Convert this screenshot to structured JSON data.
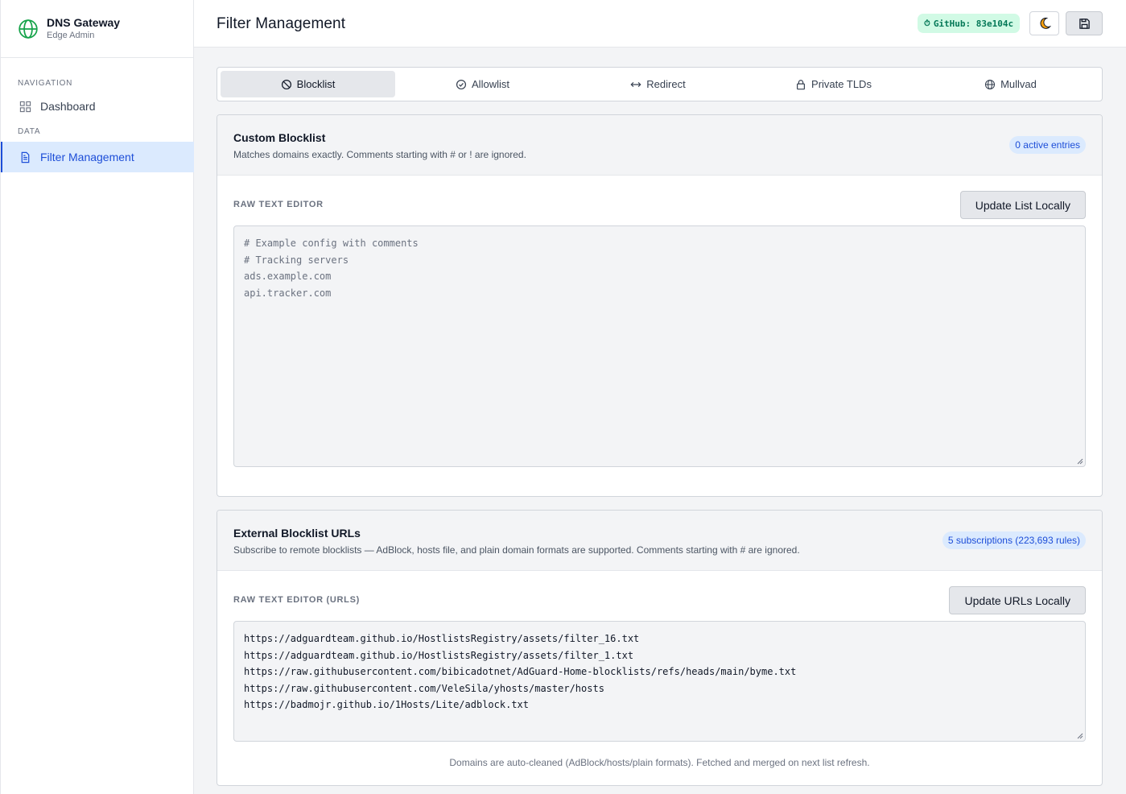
{
  "sidebar": {
    "brand_title": "DNS Gateway",
    "brand_subtitle": "Edge Admin",
    "section_navigation": "NAVIGATION",
    "section_data": "DATA",
    "items": [
      {
        "label": "Dashboard",
        "icon": "grid-icon"
      },
      {
        "label": "Filter Management",
        "icon": "document-icon",
        "active": true
      }
    ]
  },
  "header": {
    "title": "Filter Management",
    "github_badge": "GitHub: 83e104c",
    "theme_icon": "moon-icon",
    "save_icon": "floppy-disk-icon"
  },
  "tabs": [
    {
      "label": "Blocklist",
      "icon": "ban-icon",
      "active": true
    },
    {
      "label": "Allowlist",
      "icon": "check-circle-icon"
    },
    {
      "label": "Redirect",
      "icon": "arrows-horizontal-icon"
    },
    {
      "label": "Private TLDs",
      "icon": "lock-icon"
    },
    {
      "label": "Mullvad",
      "icon": "globe-icon"
    }
  ],
  "custom_blocklist": {
    "title": "Custom Blocklist",
    "description": "Matches domains exactly. Comments starting with # or ! are ignored.",
    "badge": "0 active entries",
    "editor_label": "RAW TEXT EDITOR",
    "button": "Update List Locally",
    "placeholder_lines": [
      "# Example config with comments",
      "# Tracking servers",
      "ads.example.com",
      "api.tracker.com"
    ]
  },
  "external_blocklist": {
    "title": "External Blocklist URLs",
    "description": "Subscribe to remote blocklists — AdBlock, hosts file, and plain domain formats are supported. Comments starting with # are ignored.",
    "badge": "5 subscriptions (223,693 rules)",
    "editor_label": "RAW TEXT EDITOR (URLS)",
    "button": "Update URLs Locally",
    "lines": [
      "https://adguardteam.github.io/HostlistsRegistry/assets/filter_16.txt",
      "https://adguardteam.github.io/HostlistsRegistry/assets/filter_1.txt",
      "https://raw.githubusercontent.com/bibicadotnet/AdGuard-Home-blocklists/refs/heads/main/byme.txt",
      "https://raw.githubusercontent.com/VeleSila/yhosts/master/hosts",
      "https://badmojr.github.io/1Hosts/Lite/adblock.txt"
    ],
    "footnote": "Domains are auto-cleaned (AdBlock/hosts/plain formats). Fetched and merged on next list refresh."
  },
  "colors": {
    "accent": "#1d4ed8",
    "brand_green": "#16a34a",
    "badge_green_bg": "#d1fae5"
  }
}
